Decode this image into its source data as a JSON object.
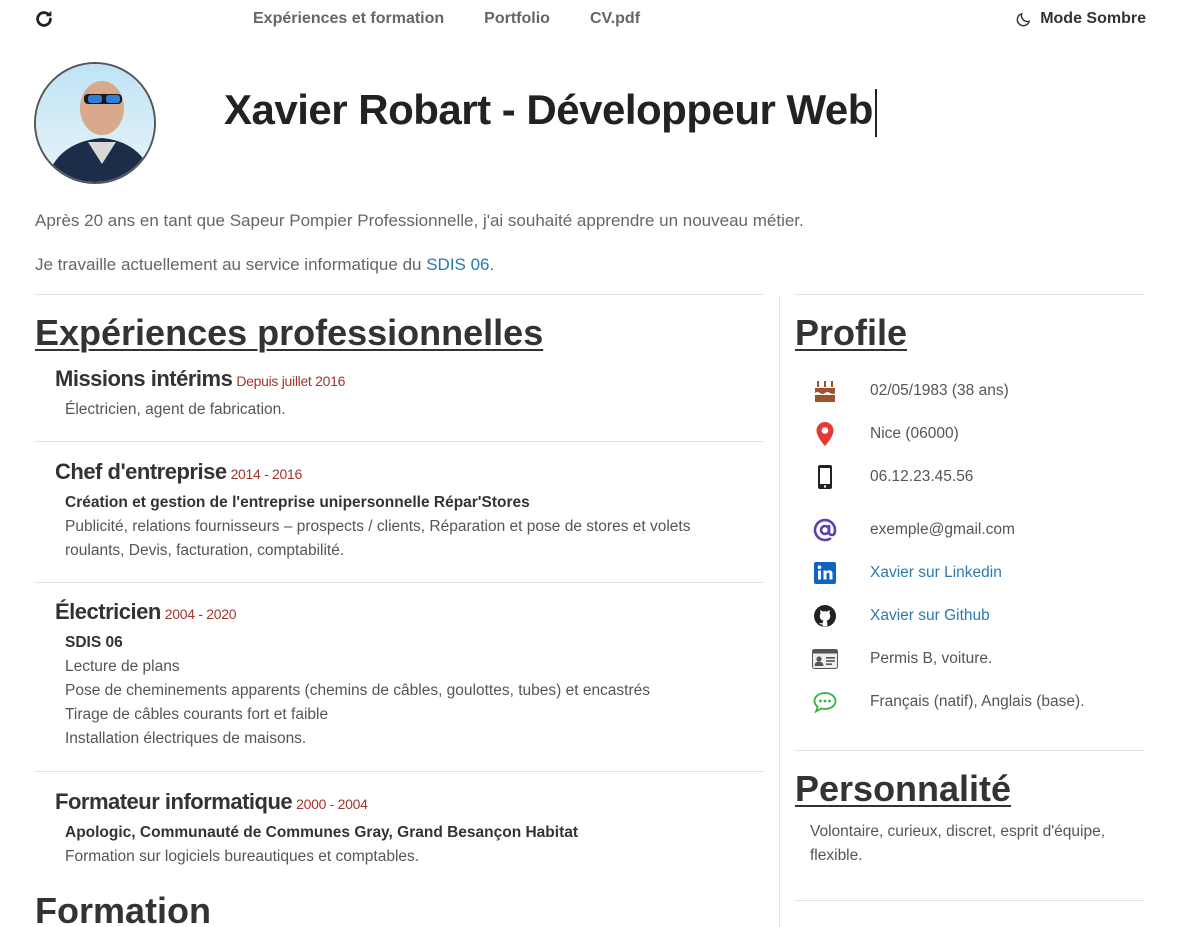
{
  "nav": {
    "links": [
      "Expériences et formation",
      "Portfolio",
      "CV.pdf"
    ],
    "dark_mode_label": "Mode Sombre"
  },
  "header": {
    "title": "Xavier Robart - Développeur Web"
  },
  "intro": {
    "line1": "Après 20 ans en tant que Sapeur Pompier Professionnelle, j'ai souhaité apprendre un nouveau métier.",
    "line2_prefix": "Je travaille actuellement au service informatique du ",
    "line2_link": "SDIS 06",
    "line2_suffix": "."
  },
  "experiences": {
    "title": "Expériences professionnelles",
    "jobs": [
      {
        "title": "Missions intérims",
        "date": "Depuis juillet 2016",
        "org": "",
        "lines": [
          "Électricien, agent de fabrication."
        ]
      },
      {
        "title": "Chef d'entreprise",
        "date": "2014 - 2016",
        "org": "Création et gestion de l'entreprise unipersonnelle Répar'Stores",
        "lines": [
          "Publicité, relations fournisseurs – prospects / clients, Réparation et pose de stores et volets",
          "roulants, Devis, facturation, comptabilité."
        ]
      },
      {
        "title": "Électricien",
        "date": "2004 - 2020",
        "org": "SDIS 06",
        "lines": [
          "Lecture de plans",
          "Pose de cheminements apparents (chemins de câbles, goulottes, tubes) et encastrés",
          "Tirage de câbles courants fort et faible",
          "Installation électriques de maisons."
        ]
      },
      {
        "title": "Formateur informatique",
        "date": "2000 - 2004",
        "org": "Apologic, Communauté de Communes Gray, Grand Besançon Habitat",
        "lines": [
          "Formation sur logiciels bureautiques et comptables."
        ]
      }
    ]
  },
  "formation": {
    "title": "Formation"
  },
  "profile": {
    "title": "Profile",
    "items": [
      {
        "icon": "birthday-cake-icon",
        "text": "02/05/1983 (38 ans)",
        "link": false
      },
      {
        "icon": "location-pin-icon",
        "text": "Nice (06000)",
        "link": false
      },
      {
        "icon": "mobile-phone-icon",
        "text": "06.12.23.45.56",
        "link": false
      },
      {
        "icon": "at-sign-icon",
        "text": "exemple@gmail.com",
        "link": false
      },
      {
        "icon": "linkedin-icon",
        "text": "Xavier sur Linkedin",
        "link": true
      },
      {
        "icon": "github-icon",
        "text": "Xavier sur Github",
        "link": true
      },
      {
        "icon": "id-card-icon",
        "text": "Permis B, voiture.",
        "link": false
      },
      {
        "icon": "speech-bubble-icon",
        "text": "Français (natif), Anglais (base).",
        "link": false
      }
    ]
  },
  "personnalite": {
    "title": "Personnalité",
    "text": "Volontaire, curieux, discret, esprit d'équipe, flexible."
  },
  "colors": {
    "link": "#2a7ab0",
    "date": "#a0362b",
    "cake": "#a0522d",
    "pin": "#e53935",
    "at": "#5c3fb3",
    "linkedin": "#0a66c2",
    "speech": "#2fb344"
  }
}
